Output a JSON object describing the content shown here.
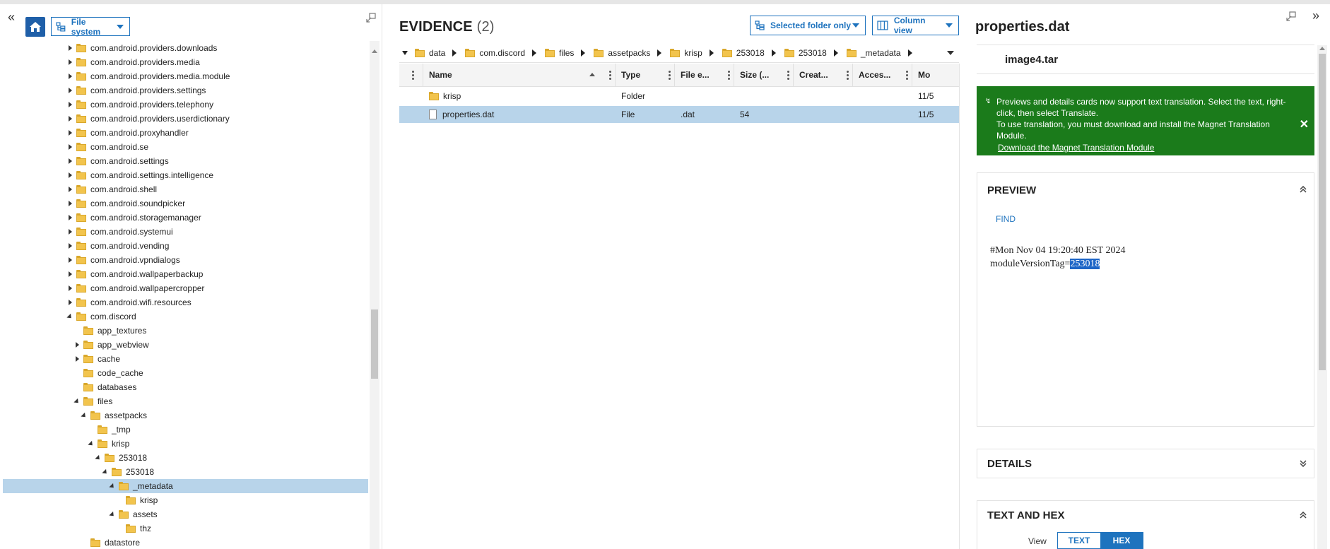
{
  "left": {
    "filesystem_label": "File system",
    "tree": [
      {
        "label": "com.android.providers.downloads",
        "indent": 0,
        "toggle": "collapsed"
      },
      {
        "label": "com.android.providers.media",
        "indent": 0,
        "toggle": "collapsed"
      },
      {
        "label": "com.android.providers.media.module",
        "indent": 0,
        "toggle": "collapsed"
      },
      {
        "label": "com.android.providers.settings",
        "indent": 0,
        "toggle": "collapsed"
      },
      {
        "label": "com.android.providers.telephony",
        "indent": 0,
        "toggle": "collapsed"
      },
      {
        "label": "com.android.providers.userdictionary",
        "indent": 0,
        "toggle": "collapsed"
      },
      {
        "label": "com.android.proxyhandler",
        "indent": 0,
        "toggle": "collapsed"
      },
      {
        "label": "com.android.se",
        "indent": 0,
        "toggle": "collapsed"
      },
      {
        "label": "com.android.settings",
        "indent": 0,
        "toggle": "collapsed"
      },
      {
        "label": "com.android.settings.intelligence",
        "indent": 0,
        "toggle": "collapsed"
      },
      {
        "label": "com.android.shell",
        "indent": 0,
        "toggle": "collapsed"
      },
      {
        "label": "com.android.soundpicker",
        "indent": 0,
        "toggle": "collapsed"
      },
      {
        "label": "com.android.storagemanager",
        "indent": 0,
        "toggle": "collapsed"
      },
      {
        "label": "com.android.systemui",
        "indent": 0,
        "toggle": "collapsed"
      },
      {
        "label": "com.android.vending",
        "indent": 0,
        "toggle": "collapsed"
      },
      {
        "label": "com.android.vpndialogs",
        "indent": 0,
        "toggle": "collapsed"
      },
      {
        "label": "com.android.wallpaperbackup",
        "indent": 0,
        "toggle": "collapsed"
      },
      {
        "label": "com.android.wallpapercropper",
        "indent": 0,
        "toggle": "collapsed"
      },
      {
        "label": "com.android.wifi.resources",
        "indent": 0,
        "toggle": "collapsed"
      },
      {
        "label": "com.discord",
        "indent": 0,
        "toggle": "expanded"
      },
      {
        "label": "app_textures",
        "indent": 1,
        "toggle": "none"
      },
      {
        "label": "app_webview",
        "indent": 1,
        "toggle": "collapsed"
      },
      {
        "label": "cache",
        "indent": 1,
        "toggle": "collapsed"
      },
      {
        "label": "code_cache",
        "indent": 1,
        "toggle": "none"
      },
      {
        "label": "databases",
        "indent": 1,
        "toggle": "none"
      },
      {
        "label": "files",
        "indent": 1,
        "toggle": "expanded"
      },
      {
        "label": "assetpacks",
        "indent": 2,
        "toggle": "expanded"
      },
      {
        "label": "_tmp",
        "indent": 3,
        "toggle": "none"
      },
      {
        "label": "krisp",
        "indent": 3,
        "toggle": "expanded"
      },
      {
        "label": "253018",
        "indent": 4,
        "toggle": "expanded"
      },
      {
        "label": "253018",
        "indent": 5,
        "toggle": "expanded"
      },
      {
        "label": "_metadata",
        "indent": 6,
        "toggle": "expanded",
        "selected": true
      },
      {
        "label": "krisp",
        "indent": 7,
        "toggle": "none"
      },
      {
        "label": "assets",
        "indent": 6,
        "toggle": "expanded"
      },
      {
        "label": "thz",
        "indent": 7,
        "toggle": "none"
      },
      {
        "label": "datastore",
        "indent": 2,
        "toggle": "none"
      }
    ]
  },
  "middle": {
    "title": "EVIDENCE",
    "count": "(2)",
    "scope_label": "Selected folder only",
    "view_label": "Column view",
    "breadcrumbs": [
      "data",
      "com.discord",
      "files",
      "assetpacks",
      "krisp",
      "253018",
      "253018",
      "_metadata"
    ],
    "columns": [
      "Name",
      "Type",
      "File e...",
      "Size (...",
      "Creat...",
      "Acces...",
      "Mo"
    ],
    "rows": [
      {
        "name": "krisp",
        "type": "Folder",
        "ext": "",
        "size": "",
        "modified": "11/5",
        "icon": "folder-icon",
        "selected": false
      },
      {
        "name": "properties.dat",
        "type": "File",
        "ext": ".dat",
        "size": "54",
        "modified": "11/5",
        "icon": "file-icon",
        "selected": true
      }
    ]
  },
  "right": {
    "title": "properties.dat",
    "source": "image4.tar",
    "banner": {
      "text": "Previews and details cards now support text translation. Select the text, right-click, then select Translate.",
      "text2": "To use translation, you must download and install the Magnet Translation Module.",
      "link": "Download the Magnet Translation Module",
      "close": "✕"
    },
    "preview": {
      "header": "PREVIEW",
      "find": "FIND",
      "line1": "#Mon Nov 04 19:20:40 EST 2024",
      "line2_prefix": "moduleVersionTag=",
      "line2_highlight": "253018"
    },
    "details_header": "DETAILS",
    "texthex": {
      "header": "TEXT AND HEX",
      "view_label": "View",
      "text_tab": "TEXT",
      "hex_tab": "HEX"
    }
  },
  "colors": {
    "accent": "#1e73be",
    "selection": "#b8d4ea",
    "banner": "#1b7b1b",
    "highlight": "#1e66c7"
  }
}
